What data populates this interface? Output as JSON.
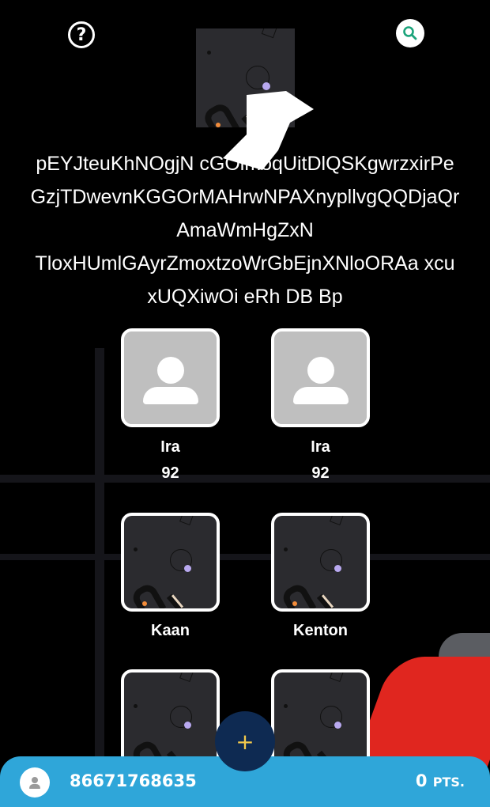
{
  "header": {
    "help_icon": "question-circle-icon",
    "help_glyph": "?",
    "search_icon": "search-icon"
  },
  "title": {
    "lines": [
      "pEYJteuKhNOgjN cGOimoqUitDlQSKgwrzxirPe",
      "GzjTDwevnKGGOrMAHrwNPAXnypllvgQQDjaQr",
      "AmaWmHgZxN",
      "TloxHUmlGAyrZmoxtzoWrGbEjnXNloORAa xcu",
      "xUQXiwOi eRh DB Bp"
    ]
  },
  "tiles": [
    {
      "name": "Ira",
      "score": "92",
      "image": "default-avatar"
    },
    {
      "name": "Ira",
      "score": "92",
      "image": "default-avatar"
    },
    {
      "name": "Kaan",
      "score": "",
      "image": "pattern-art"
    },
    {
      "name": "Kenton",
      "score": "",
      "image": "pattern-art"
    },
    {
      "name": "",
      "score": "",
      "image": "pattern-art"
    },
    {
      "name": "",
      "score": "",
      "image": "pattern-art"
    }
  ],
  "fab": {
    "glyph": "+",
    "icon": "plus-icon"
  },
  "footer": {
    "user_number": "86671768635",
    "points_value": "0",
    "points_unit": "PTS."
  },
  "colors": {
    "background": "#000000",
    "footer_bar": "#2fa6d9",
    "fab": "#0e2a52",
    "fab_plus": "#f2c94c",
    "search_icon": "#1aa37a"
  }
}
